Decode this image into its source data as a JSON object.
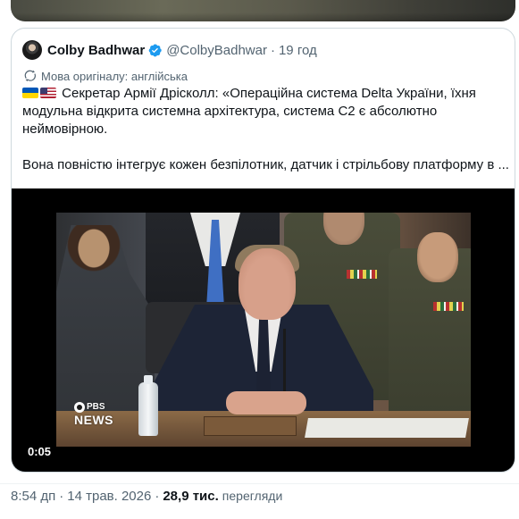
{
  "quote": {
    "author_name": "Colby Badhwar",
    "handle": "@ColbyBadhwar",
    "separator": "·",
    "time": "19 год",
    "translate_label": "Мова оригіналу: англійська",
    "text_paragraph_1": "Секретар Армії Дрісколл: «Операційна система Delta України, їхня модульна відкрита системна архітектура, система С2 є абсолютно неймовірною.",
    "text_paragraph_2": "Вона повністю інтегрує кожен безпілотник, датчик і стрільбову платформу в ...",
    "video": {
      "duration": "0:05",
      "logo_top": "PBS",
      "logo_bottom": "NEWS"
    }
  },
  "meta": {
    "time": "8:54 дп",
    "separator": "·",
    "date": "14 трав. 2026",
    "separator_2": "·",
    "views_count": "28,9 тис.",
    "views_label": "перегляди"
  },
  "colors": {
    "accent": "#1d9bf0",
    "text_primary": "#0f1419",
    "text_secondary": "#536471",
    "border": "#cfd9de"
  },
  "icons": {
    "verified": "verified-badge-icon",
    "translate": "translate-icon",
    "flags": [
      "ukraine-flag-icon",
      "usa-flag-icon"
    ]
  }
}
